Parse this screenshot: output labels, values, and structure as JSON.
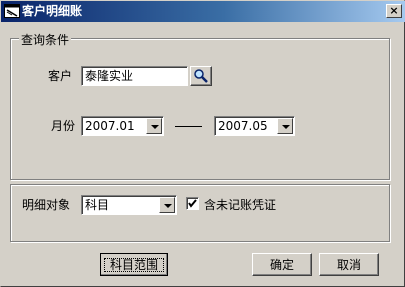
{
  "window": {
    "title": "客户明细账",
    "close_glyph": "×"
  },
  "query_group": {
    "legend": "查询条件"
  },
  "customer": {
    "label": "客户",
    "value": "泰隆实业",
    "search_icon": "search-icon"
  },
  "month": {
    "label": "月份",
    "from": "2007.01",
    "separator": "——",
    "to": "2007.05"
  },
  "detail": {
    "label": "明细对象",
    "selected": "科目",
    "checkbox_label": "含未记账凭证",
    "checked": true
  },
  "buttons": {
    "subject_range": "科目范围",
    "ok": "确定",
    "cancel": "取消"
  },
  "colors": {
    "title_start": "#0a246a",
    "title_end": "#a6caf0",
    "face": "#d4d0c8"
  }
}
